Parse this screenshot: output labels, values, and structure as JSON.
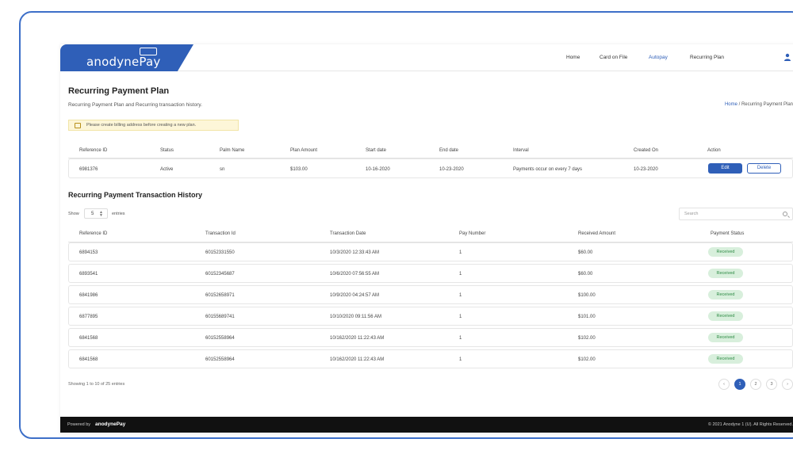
{
  "brand": {
    "name": "anodynePay",
    "primary": "#2f5fb8"
  },
  "nav": {
    "items": [
      "Home",
      "Card on File",
      "Autopay",
      "Recurring Plan"
    ],
    "active": "Autopay"
  },
  "page": {
    "title": "Recurring Payment Plan",
    "subtitle": "Recurring Payment Plan and Recurring transaction history.",
    "breadcrumb_home": "Home",
    "breadcrumb_sep": " / ",
    "breadcrumb_current": "Recurring Payment Plan"
  },
  "alert": {
    "text": "Please create billing address before creating a new plan.",
    "icon": "lock-icon"
  },
  "plan_table": {
    "headers": [
      "Reference ID",
      "Status",
      "Palm Name",
      "Plan Amount",
      "Start date",
      "End date",
      "Interval",
      "Created On",
      "Action"
    ],
    "row": {
      "reference_id": "6981376",
      "status": "Active",
      "palm_name": "sn",
      "plan_amount": "$103.00",
      "start_date": "10-16-2020",
      "end_date": "10-23-2020",
      "interval": "Payments occur on every 7 days",
      "created_on": "10-23-2020"
    },
    "edit_label": "Edit",
    "delete_label": "Delete"
  },
  "history": {
    "title": "Recurring Payment Transaction History",
    "show_label": "Show",
    "entries_value": "5",
    "entries_label": "entries",
    "search_placeholder": "Search",
    "headers": [
      "Reference ID",
      "Transaction Id",
      "Transaction Date",
      "Pay Number",
      "Received Amount",
      "Payment Status"
    ],
    "rows": [
      {
        "ref": "6894153",
        "txn": "60152331550",
        "date": "10/3/2020 12:33:43 AM",
        "pay": "1",
        "amount": "$60.00",
        "status": "Received"
      },
      {
        "ref": "6893541",
        "txn": "60152345687",
        "date": "10/6/2020 07:56:55 AM",
        "pay": "1",
        "amount": "$60.00",
        "status": "Received"
      },
      {
        "ref": "6841986",
        "txn": "60152658971",
        "date": "10/9/2020 04:24:57 AM",
        "pay": "1",
        "amount": "$100.00",
        "status": "Received"
      },
      {
        "ref": "6877895",
        "txn": "60155689741",
        "date": "10/10/2020 09:11:56 AM",
        "pay": "1",
        "amount": "$101.00",
        "status": "Received"
      },
      {
        "ref": "6841568",
        "txn": "60152558964",
        "date": "10/162/2020 11:22:43 AM",
        "pay": "1",
        "amount": "$102.00",
        "status": "Received"
      },
      {
        "ref": "6841568",
        "txn": "60152558964",
        "date": "10/162/2020 11:22:43 AM",
        "pay": "1",
        "amount": "$102.00",
        "status": "Received"
      }
    ],
    "showing_text": "Showing 1 to 10 of 25 entries",
    "pagination": {
      "prev": "‹",
      "pages": [
        "1",
        "2",
        "3"
      ],
      "current": "1",
      "next": "›"
    }
  },
  "footer": {
    "powered_by": "Powered by",
    "brand": "anodynePay",
    "copyright": "© 2021 Anodyne 1 (U). All Rights Reserved."
  }
}
